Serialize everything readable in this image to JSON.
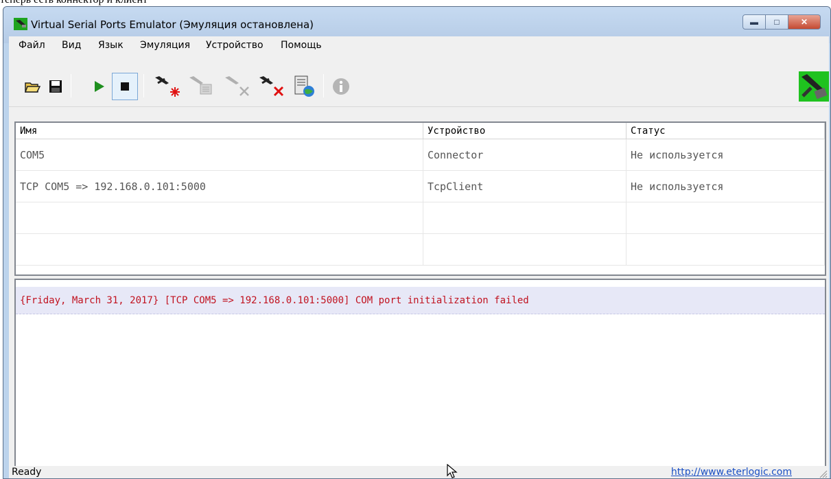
{
  "caption": "теперь есть коннектор и клиент",
  "window": {
    "title": "Virtual Serial Ports Emulator (Эмуляция остановлена)"
  },
  "menu": [
    "Файл",
    "Вид",
    "Язык",
    "Эмуляция",
    "Устройство",
    "Помощь"
  ],
  "list": {
    "columns": [
      "Имя",
      "Устройство",
      "Статус"
    ],
    "rows": [
      {
        "name": "COM5",
        "device": "Connector",
        "status": "Не используется"
      },
      {
        "name": "TCP COM5 => 192.168.0.101:5000",
        "device": "TcpClient",
        "status": "Не используется"
      }
    ]
  },
  "log": {
    "entries": [
      "{Friday, March 31, 2017} [TCP COM5 => 192.168.0.101:5000] COM port initialization failed"
    ]
  },
  "status": {
    "text": "Ready",
    "link": "http://www.eterlogic.com"
  },
  "colors": {
    "log_error": "#c1121f",
    "log_row_bg": "#e7e8f7",
    "title_bar": "#bcd3ec",
    "link": "#1a4fc4"
  },
  "icons": {
    "toolbar": [
      "open-folder-icon",
      "save-disk-icon",
      "play-icon",
      "stop-icon",
      "create-device-icon",
      "device-properties-icon",
      "remove-device-icon",
      "delete-device-icon",
      "network-settings-icon",
      "info-icon"
    ],
    "app_logo": "serial-cable-logo-icon"
  }
}
